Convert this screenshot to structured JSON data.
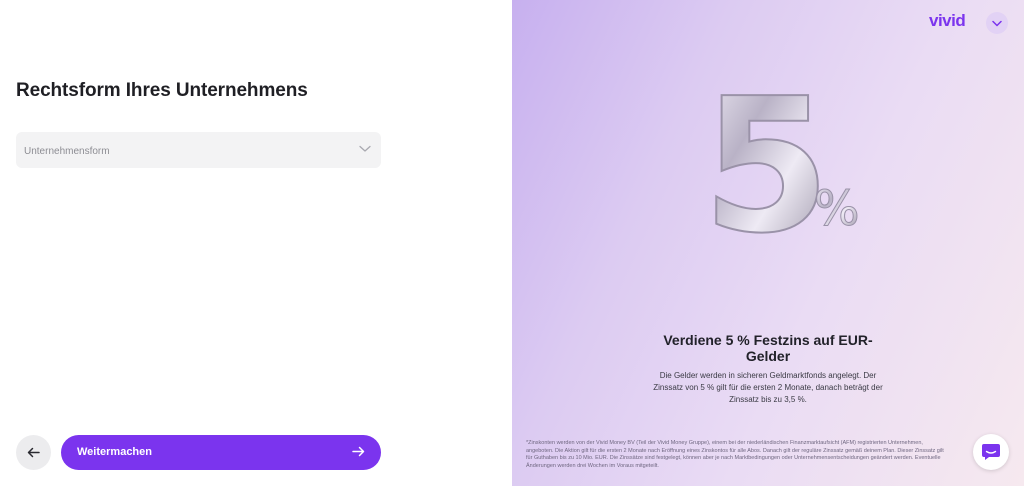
{
  "form": {
    "title": "Rechtsform Ihres Unternehmens",
    "select_placeholder": "Unternehmensform",
    "continue_label": "Weitermachen"
  },
  "brand": {
    "logo_text": "vivid",
    "accent_color": "#7b34ee"
  },
  "promo": {
    "number": "5",
    "percent_sign": "%",
    "headline": "Verdiene 5 % Festzins auf EUR-Gelder",
    "body": "Die Gelder werden in sicheren Geldmarktfonds angelegt. Der Zinssatz von 5 % gilt für die ersten 2 Monate, danach beträgt der Zinssatz bis zu 3,5 %.",
    "fine_print": "*Zinskonten werden von der Vivid Money BV (Teil der Vivid Money Gruppe), einem bei der niederländischen Finanzmarktaufsicht (AFM) registrierten Unternehmen, angeboten. Die Aktion gilt für die ersten 2 Monate nach Eröffnung eines Zinskontos für alle Abos. Danach gilt der reguläre Zinssatz gemäß deinem Plan. Dieser Zinssatz gilt für Guthaben bis zu 10 Mio. EUR. Die Zinssätze sind festgelegt, können aber je nach Marktbedingungen oder Unternehmensentscheidungen geändert werden. Eventuelle Änderungen werden drei Wochen im Voraus mitgeteilt."
  },
  "icons": {
    "back": "arrow-left-icon",
    "next": "arrow-right-icon",
    "select_chevron": "chevron-down-icon",
    "language": "chevron-down-icon",
    "chat": "chat-icon"
  }
}
